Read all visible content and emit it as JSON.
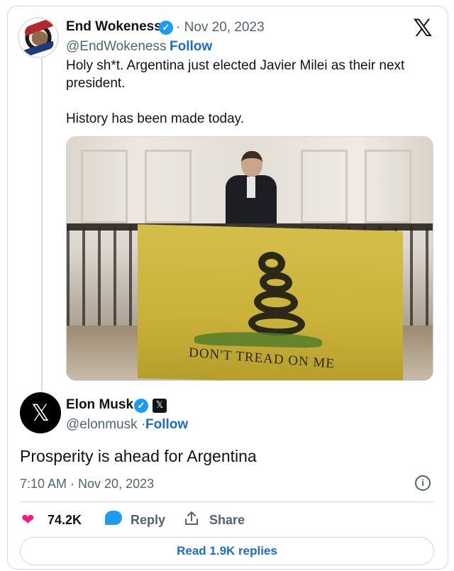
{
  "quoted_tweet": {
    "author_name": "End Wokeness",
    "date": "· Nov 20, 2023",
    "handle": "@EndWokeness ·",
    "follow_label": "Follow",
    "text_lines": [
      "Holy sh*t. Argentina just elected Javier Milei as their next president.",
      "History has been made today."
    ],
    "image_caption_text": "DON'T TREAD ON ME",
    "avatar_icon": "i-support-former-things-badge-icon"
  },
  "main_tweet": {
    "author_name": "Elon Musk",
    "handle": "@elonmusk ·",
    "follow_label": "Follow",
    "text": "Prosperity is ahead for Argentina",
    "timestamp": "7:10 AM · Nov 20, 2023",
    "avatar_glyph": "𝕏",
    "badge_glyph": "𝕏"
  },
  "actions": {
    "likes": "74.2K",
    "reply_label": "Reply",
    "share_label": "Share",
    "read_replies_label": "Read 1.9K replies"
  },
  "icons": {
    "verified": "✓",
    "x_logo": "𝕏",
    "info": "i",
    "heart": "❤"
  },
  "colors": {
    "verified_blue": "#1d9bf0",
    "link_blue": "#1d6cc4",
    "heart_pink": "#f91880",
    "secondary_text": "#536471"
  }
}
